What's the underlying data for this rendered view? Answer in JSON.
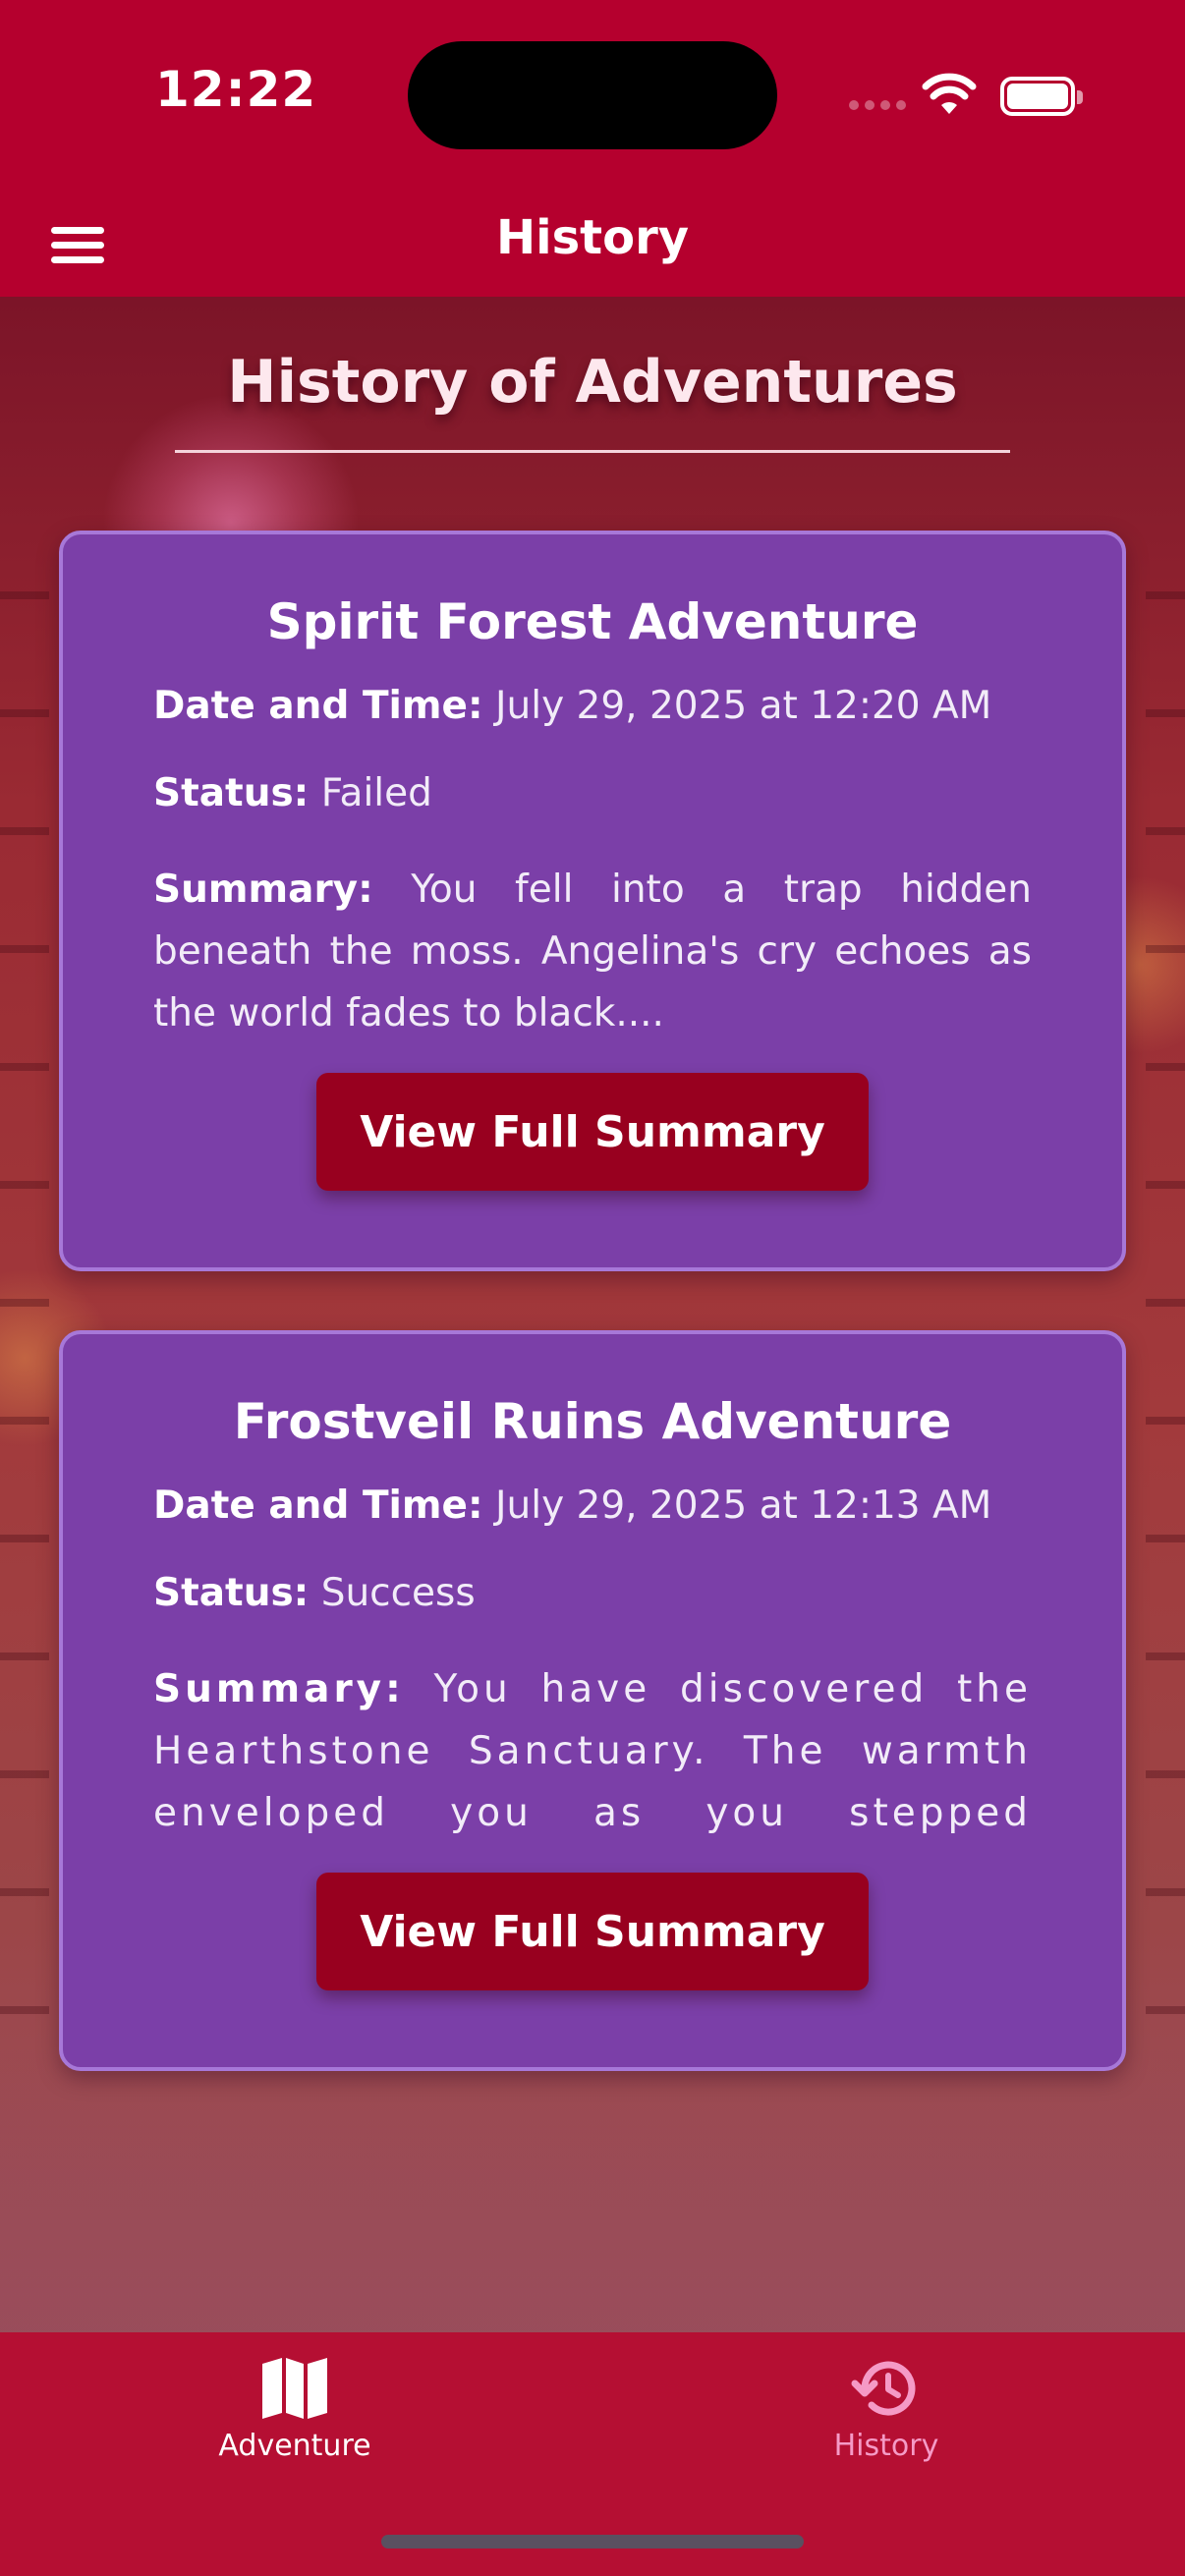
{
  "status_bar": {
    "time": "12:22"
  },
  "header": {
    "title": "History",
    "menu_icon": "hamburger-menu-icon"
  },
  "page": {
    "title": "History of Adventures"
  },
  "labels": {
    "date": "Date and Time:",
    "status": "Status:",
    "summary": "Summary:",
    "button": "View Full Summary"
  },
  "adventures": [
    {
      "title": "Spirit Forest Adventure",
      "date": "July 29, 2025 at 12:20 AM",
      "status": "Failed",
      "summary": "You fell into a trap hidden beneath the moss. Angelina's cry echoes as the world fades to black...."
    },
    {
      "title": "Frostveil Ruins Adventure",
      "date": "July 29, 2025 at 12:13 AM",
      "status": "Success",
      "summary": "You have discovered the Hearthstone Sanctuary. The warmth enveloped you as you stepped through the p..."
    }
  ],
  "tabbar": {
    "items": [
      {
        "label": "Adventure",
        "icon": "map-icon"
      },
      {
        "label": "History",
        "icon": "history-icon"
      }
    ]
  },
  "colors": {
    "header": "#b5002e",
    "card": "#7b3fa8",
    "card_border": "#a778d8",
    "button": "#98001f",
    "active_tab": "#f59ac6"
  }
}
